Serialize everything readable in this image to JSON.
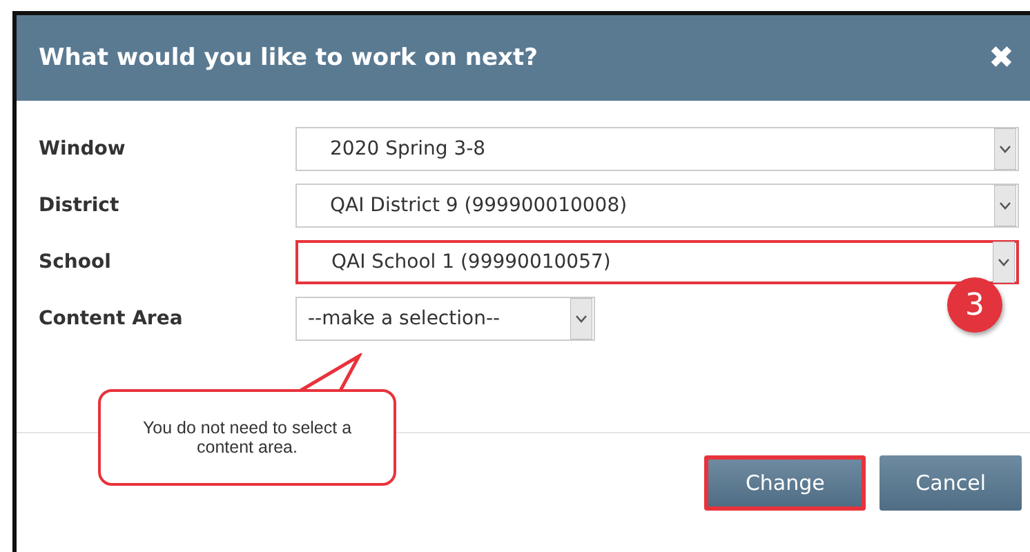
{
  "dialog": {
    "title": "What would you like to work on next?",
    "close": "✖"
  },
  "fields": [
    {
      "label": "Window",
      "value": "2020 Spring 3-8",
      "highlighted": false,
      "kind": "wide"
    },
    {
      "label": "District",
      "value": "QAI District 9 (999900010008)",
      "highlighted": false,
      "kind": "wide"
    },
    {
      "label": "School",
      "value": "QAI School 1 (99990010057)",
      "highlighted": true,
      "kind": "wide"
    },
    {
      "label": "Content Area",
      "value": "--make a selection--",
      "highlighted": false,
      "kind": "narrow"
    }
  ],
  "step_badge": "3",
  "callout": {
    "text": "You do not need to select a content area."
  },
  "buttons": [
    {
      "label": "Change",
      "highlighted": true
    },
    {
      "label": "Cancel",
      "highlighted": false
    }
  ]
}
